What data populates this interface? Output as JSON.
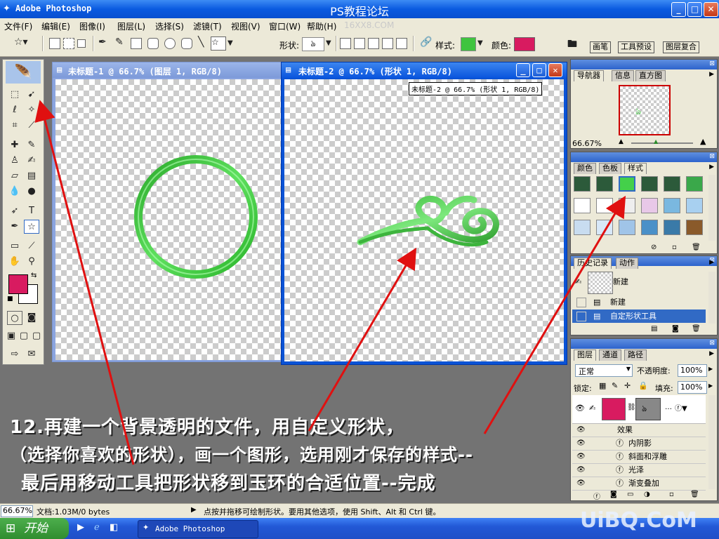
{
  "titlebar": {
    "app_title": "Adobe Photoshop",
    "center_title": "PS教程论坛"
  },
  "menubar": {
    "items": [
      "文件(F)",
      "编辑(E)",
      "图像(I)",
      "图层(L)",
      "选择(S)",
      "滤镜(T)",
      "视图(V)",
      "窗口(W)",
      "帮助(H)"
    ],
    "watermark": "16XX8.COM"
  },
  "optionsbar": {
    "shape_label": "形状:",
    "style_label": "样式:",
    "color_label": "颜色:",
    "color_value": "#d81b60",
    "palette_tabs": [
      "画笔",
      "工具预设",
      "图层复合"
    ]
  },
  "toolbox": {
    "icons": [
      "marquee-icon",
      "move-icon",
      "lasso-icon",
      "magic-wand-icon",
      "crop-icon",
      "slice-icon",
      "healing-icon",
      "brush-icon",
      "stamp-icon",
      "history-brush-icon",
      "eraser-icon",
      "gradient-icon",
      "blur-icon",
      "dodge-icon",
      "path-select-icon",
      "type-icon",
      "pen-icon",
      "custom-shape-icon",
      "notes-icon",
      "eyedropper-icon",
      "hand-icon",
      "zoom-icon"
    ],
    "fg_color": "#d81b60",
    "bg_color": "#ffffff"
  },
  "doc1": {
    "title": "未标题-1 @ 66.7% (图层 1, RGB/8)",
    "ring_color": "#3ccc3c"
  },
  "doc2": {
    "title": "未标题-2 @ 66.7% (形状 1, RGB/8)",
    "tooltip": "未标题-2 @ 66.7% (形状 1, RGB/8)",
    "shape_color": "#4cc74c"
  },
  "navigator": {
    "tabs": [
      "导航器",
      "信息",
      "直方图"
    ],
    "zoom": "66.67%"
  },
  "styles_panel": {
    "tabs": [
      "颜色",
      "色板",
      "样式"
    ],
    "swatches": [
      "#2c5a3a",
      "#2c5a3a",
      "#44d04a",
      "#2c5a3a",
      "#2c5a3a",
      "#3aa84a",
      "#ffffff",
      "#ffffff",
      "#eeeeee",
      "#e8c8e8",
      "#7ab8e0",
      "#a8d0f0",
      "#c8dcf0",
      "#d8e8f8",
      "#a0c4e8",
      "#4a90c8",
      "#3a7aa8",
      "#8a5a2a"
    ]
  },
  "history_panel": {
    "tabs": [
      "历史记录",
      "动作"
    ],
    "snapshot": "新建",
    "items": [
      "新建",
      "自定形状工具"
    ]
  },
  "layers_panel": {
    "tabs": [
      "图层",
      "通道",
      "路径"
    ],
    "blend_mode": "正常",
    "opacity_label": "不透明度:",
    "opacity_value": "100%",
    "lock_label": "锁定:",
    "fill_label": "填充:",
    "fill_value": "100%",
    "effects_header": "效果",
    "effects": [
      "内阴影",
      "斜面和浮雕",
      "光泽",
      "渐变叠加"
    ],
    "layer_color": "#d81b60"
  },
  "statusbar": {
    "zoom": "66.67%",
    "doc_info": "文档:1.03M/0 bytes",
    "hint": "点按并拖移可绘制形状。要用其他选项，使用 Shift、Alt 和 Ctrl 键。"
  },
  "taskbar": {
    "start_label": "开始",
    "task_label": "Adobe Photoshop",
    "watermark": "UiBQ.CoM"
  },
  "annotation": {
    "line1": "12.再建一个背景透明的文件，用自定义形状，",
    "line2": "（选择你喜欢的形状），画一个图形，选用刚才保存的样式--",
    "line3": "最后用移动工具把形状移到玉环的合适位置--完成"
  },
  "colors": {
    "arrow": "#e01010",
    "ps_blue": "#0a55dd"
  }
}
